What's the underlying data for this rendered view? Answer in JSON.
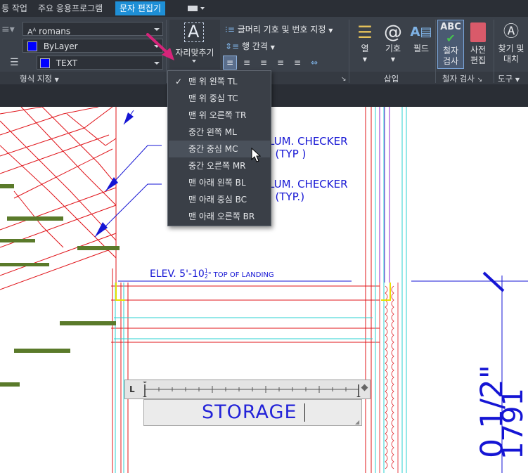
{
  "tabs": [
    {
      "label": "등 작업"
    },
    {
      "label": "주요 응용프로그램"
    },
    {
      "label": "문자 편집기",
      "active": true
    }
  ],
  "format_panel": {
    "font_value": "romans",
    "color_value": "ByLayer",
    "layer_value": "TEXT",
    "label": "형식 지정"
  },
  "justify_button": {
    "label": "자리맞추기"
  },
  "paragraph_panel": {
    "bullets_label": "글머리 기호 및 번호 지정",
    "spacing_label": "행 간격"
  },
  "insert_panel": {
    "column_label": "열",
    "symbol_label": "기호",
    "field_label": "필드",
    "label": "삽입"
  },
  "spell_panel": {
    "spellcheck_label_1": "철자",
    "spellcheck_label_2": "검사",
    "dict_label_1": "사전",
    "dict_label_2": "편집",
    "label": "철자 검사"
  },
  "tools_panel": {
    "find_label_1": "찾기 및",
    "find_label_2": "대치",
    "label": "도구"
  },
  "justify_menu": {
    "items": [
      {
        "label": "맨 위 왼쪽 TL",
        "checked": true
      },
      {
        "label": "맨 위 중심 TC"
      },
      {
        "label": "맨 위 오른쪽 TR"
      },
      {
        "label": "중간 왼쪽 ML"
      },
      {
        "label": "중간 중심 MC",
        "highlighted": true
      },
      {
        "label": "중간 오른쪽 MR"
      },
      {
        "label": "맨 아래 왼쪽 BL"
      },
      {
        "label": "맨 아래 중심 BC"
      },
      {
        "label": "맨 아래 오른쪽 BR"
      }
    ]
  },
  "drawing": {
    "note1_line1": "LUM. CHECKER",
    "note1_line2": ". (TYP )",
    "note2_line1": "LUM. CHECKER",
    "note2_line2": ". (TYP.)",
    "elev_text": "ELEV. 5'-10",
    "elev_frac_num": "1",
    "elev_frac_den": "2",
    "elev_suffix": "\" TOP OF LANDING",
    "dim_text_1": "0 1/2\"",
    "dim_text_2": "1791"
  },
  "text_editor": {
    "value": "STORAGE"
  }
}
